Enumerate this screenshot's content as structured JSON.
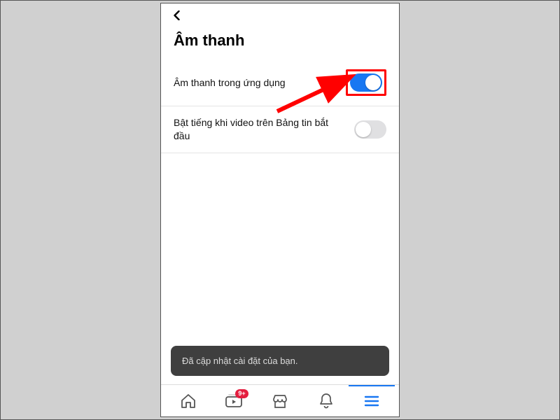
{
  "header": {
    "title": "Âm thanh"
  },
  "settings": [
    {
      "label": "Âm thanh trong ứng dụng",
      "on": true,
      "highlighted": true
    },
    {
      "label": "Bật tiếng khi video trên Bảng tin bắt đầu",
      "on": false,
      "highlighted": false
    }
  ],
  "toast": {
    "message": "Đã cập nhật cài đặt của bạn."
  },
  "tabs": {
    "watch_badge": "9+"
  },
  "colors": {
    "accent": "#1877f2",
    "highlight": "#ff0000",
    "badge": "#e41e3f"
  }
}
